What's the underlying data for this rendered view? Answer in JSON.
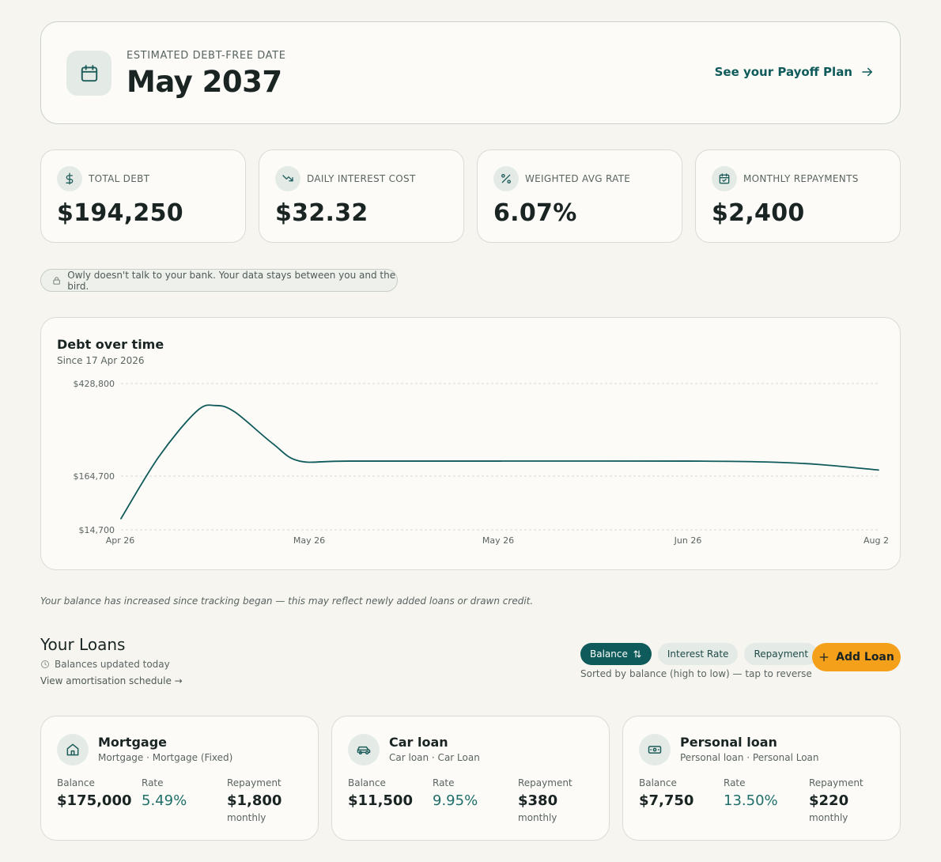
{
  "hero": {
    "eyebrow": "ESTIMATED DEBT-FREE DATE",
    "date": "May 2037",
    "link_label": "See your Payoff Plan",
    "icon": "calendar-icon"
  },
  "stats": [
    {
      "label": "TOTAL DEBT",
      "value": "$194,250",
      "icon": "dollar-icon"
    },
    {
      "label": "DAILY INTEREST COST",
      "value": "$32.32",
      "icon": "trending-down-icon"
    },
    {
      "label": "WEIGHTED AVG RATE",
      "value": "6.07%",
      "icon": "percent-icon"
    },
    {
      "label": "MONTHLY REPAYMENTS",
      "value": "$2,400",
      "icon": "calendar-check-icon"
    }
  ],
  "privacy_note": "Owly doesn't talk to your bank. Your data stays between you and the bird.",
  "chart": {
    "title": "Debt over time",
    "subtitle": "Since 17 Apr 2026"
  },
  "chart_data": {
    "type": "line",
    "title": "Debt over time",
    "subtitle": "Since 17 Apr 2026",
    "y_ticks": [
      "$428,800",
      "$164,700",
      "$14,700"
    ],
    "y_tick_values": [
      428800,
      164700,
      14700
    ],
    "x_ticks": [
      "Apr 26",
      "May 26",
      "May 26",
      "Jun 26",
      "Aug 2"
    ],
    "ylim": [
      14700,
      428800
    ],
    "grid": true,
    "color": "#0f5a5a",
    "series": [
      {
        "x": [
          0,
          0.05,
          0.1,
          0.125,
          0.15,
          0.2,
          0.235,
          0.3,
          0.5,
          0.75,
          0.85,
          0.92,
          1.0
        ],
        "values": [
          46000,
          220000,
          350000,
          366000,
          348000,
          258000,
          208000,
          207500,
          207500,
          207500,
          205000,
          198000,
          182000
        ]
      }
    ]
  },
  "balance_note": "Your balance has increased since tracking began — this may reflect newly added loans or drawn credit.",
  "loans_section": {
    "title": "Your Loans",
    "updated": "Balances updated today",
    "schedule_link": "View amortisation schedule →",
    "sort_options": [
      "Balance",
      "Interest Rate",
      "Repayment"
    ],
    "sort_hint": "Sorted by balance (high to low) — tap to reverse",
    "add_label": "Add Loan",
    "balance_label": "Balance",
    "rate_label": "Rate",
    "repayment_label": "Repayment",
    "monthly_label": "monthly"
  },
  "loans": [
    {
      "name": "Mortgage",
      "type": "Mortgage · Mortgage (Fixed)",
      "balance": "$175,000",
      "rate": "5.49%",
      "repayment": "$1,800",
      "icon": "home-icon"
    },
    {
      "name": "Car loan",
      "type": "Car loan · Car Loan",
      "balance": "$11,500",
      "rate": "9.95%",
      "repayment": "$380",
      "icon": "car-icon"
    },
    {
      "name": "Personal loan",
      "type": "Personal loan · Personal Loan",
      "balance": "$7,750",
      "rate": "13.50%",
      "repayment": "$220",
      "icon": "banknote-icon"
    }
  ]
}
